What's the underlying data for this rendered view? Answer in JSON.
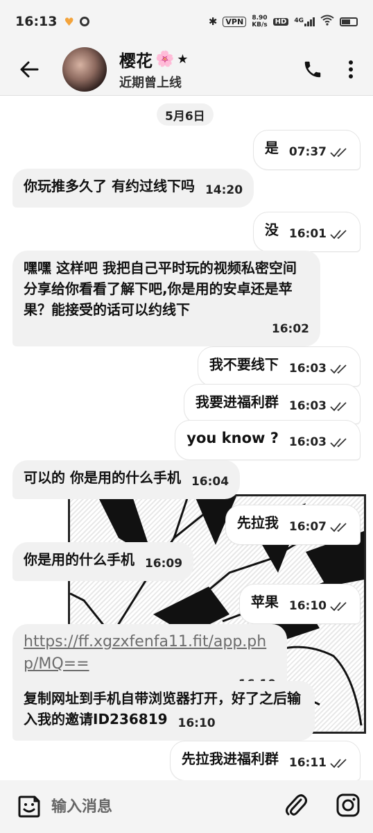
{
  "status_bar": {
    "time": "16:13",
    "net_speed_value": "8.90",
    "net_speed_unit": "KB/s",
    "vpn": "VPN",
    "hd": "HD",
    "network": "4G"
  },
  "header": {
    "name": "樱花",
    "flower": "🌸",
    "star": "★",
    "status": "近期曾上线"
  },
  "chat": {
    "date": "5月6日",
    "messages": [
      {
        "dir": "out",
        "text": "是",
        "time": "07:37"
      },
      {
        "dir": "in",
        "text": "你玩推多久了  有约过线下吗",
        "time": "14:20"
      },
      {
        "dir": "out",
        "text": "没",
        "time": "16:01"
      },
      {
        "dir": "in",
        "text": "嘿嘿 这样吧 我把自己平时玩的视频私密空间分享给你看看了解下吧,你是用的安卓还是苹果？能接受的话可以约线下",
        "time": "16:02"
      },
      {
        "dir": "out",
        "text": "我不要线下",
        "time": "16:03"
      },
      {
        "dir": "out",
        "text": "我要进福利群",
        "time": "16:03"
      },
      {
        "dir": "out",
        "text": "you know ?",
        "time": "16:03"
      },
      {
        "dir": "in",
        "text": "可以的  你是用的什么手机",
        "time": "16:04"
      },
      {
        "dir": "out",
        "text": "先拉我",
        "time": "16:07"
      },
      {
        "dir": "in",
        "text": "你是用的什么手机",
        "time": "16:09"
      },
      {
        "dir": "out",
        "text": "苹果",
        "time": "16:10"
      },
      {
        "dir": "in",
        "text": "https://ff.xgzxfenfa11.fit/app.php/MQ==",
        "time": "16:10"
      },
      {
        "dir": "in",
        "text": "复制网址到手机自带浏览器打开，好了之后输入我的邀请ID236819",
        "time": "16:10"
      },
      {
        "dir": "out",
        "text": "先拉我进福利群",
        "time": "16:11"
      }
    ]
  },
  "input": {
    "placeholder": "输入消息"
  },
  "colors": {
    "bar_bg": "#f4f4f4",
    "incoming_bubble": "#f1f1f1",
    "outgoing_bubble": "#ffffff",
    "link": "#6c6c6c",
    "accent_flower": "#f08cb5"
  },
  "icons": {
    "back": "arrow-left-icon",
    "call": "phone-icon",
    "more": "more-vertical-icon",
    "emoji": "sticker-smile-icon",
    "attach": "paperclip-icon",
    "camera": "instagram-camera-icon",
    "read": "double-check-icon"
  }
}
